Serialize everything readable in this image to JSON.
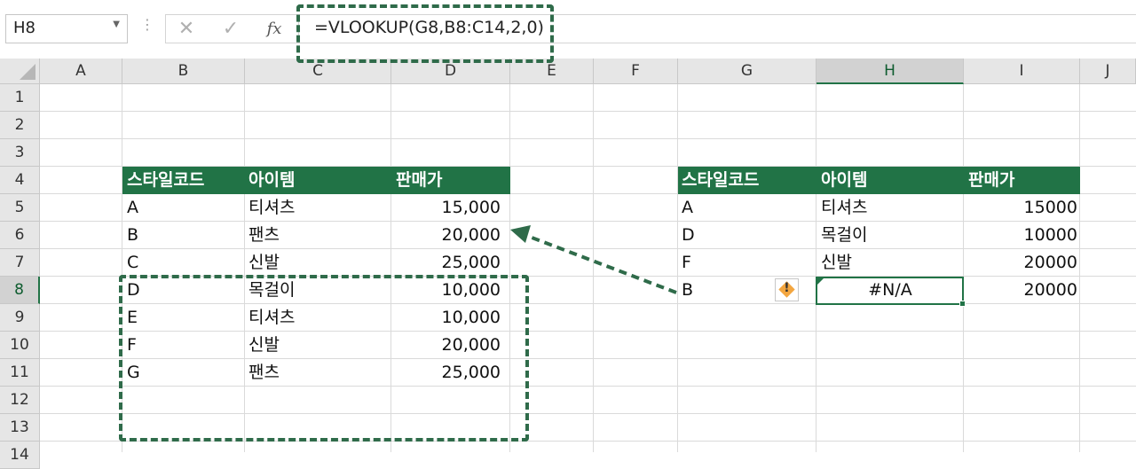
{
  "formula_bar": {
    "name_box": "H8",
    "cancel_icon": "✕",
    "enter_icon": "✓",
    "fx_label": "fx",
    "formula": "=VLOOKUP(G8,B8:C14,2,0)"
  },
  "columns": [
    "A",
    "B",
    "C",
    "D",
    "E",
    "F",
    "G",
    "H",
    "I",
    "J"
  ],
  "rows": [
    "1",
    "2",
    "3",
    "4",
    "5",
    "6",
    "7",
    "8",
    "9",
    "10",
    "11",
    "12",
    "13",
    "14"
  ],
  "selected_cell": "H8",
  "left_table": {
    "headers": [
      "스타일코드",
      "아이템",
      "판매가"
    ],
    "rows": [
      [
        "A",
        "티셔츠",
        "15,000"
      ],
      [
        "B",
        "팬츠",
        "20,000"
      ],
      [
        "C",
        "신발",
        "25,000"
      ],
      [
        "D",
        "목걸이",
        "10,000"
      ],
      [
        "E",
        "티셔츠",
        "10,000"
      ],
      [
        "F",
        "신발",
        "20,000"
      ],
      [
        "G",
        "팬츠",
        "25,000"
      ]
    ]
  },
  "right_table": {
    "headers": [
      "스타일코드",
      "아이템",
      "판매가"
    ],
    "rows": [
      [
        "A",
        "티셔츠",
        "15000"
      ],
      [
        "D",
        "목걸이",
        "10000"
      ],
      [
        "F",
        "신발",
        "20000"
      ],
      [
        "B",
        "#N/A",
        "20000"
      ]
    ]
  },
  "icons": {
    "error_warning": "warning-icon"
  },
  "colors": {
    "accent": "#217346",
    "annotation": "#2f6b4a",
    "warning": "#f3a640"
  }
}
